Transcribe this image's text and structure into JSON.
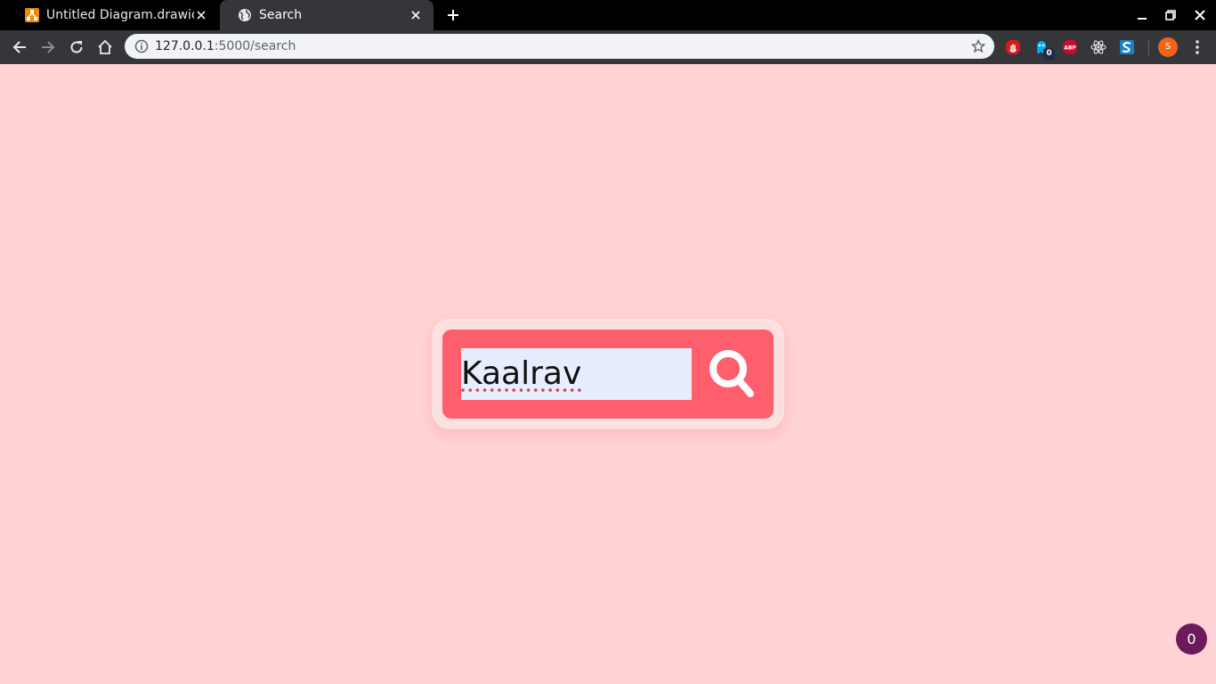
{
  "tabs": [
    {
      "title": "Untitled Diagram.drawio",
      "active": false,
      "favicon": "drawio-icon"
    },
    {
      "title": "Search",
      "active": true,
      "favicon": "globe-icon"
    }
  ],
  "address_bar": {
    "host": "127.0.0.1",
    "path": ":5000/search"
  },
  "extensions": [
    "stop-hand-icon",
    "ghostery-icon",
    "adblock-plus-icon",
    "react-devtools-icon",
    "s-extension-icon"
  ],
  "extension_badge": "0",
  "profile": {
    "initial": "S"
  },
  "search": {
    "value": "Kaalrav",
    "button_icon": "magnifier-icon"
  },
  "floating_badge": "0",
  "colors": {
    "page_bg": "#ffd3d5",
    "card_bg": "#ff5e6c",
    "input_bg": "#e6eefd",
    "fab_bg": "#6c1a5c"
  }
}
